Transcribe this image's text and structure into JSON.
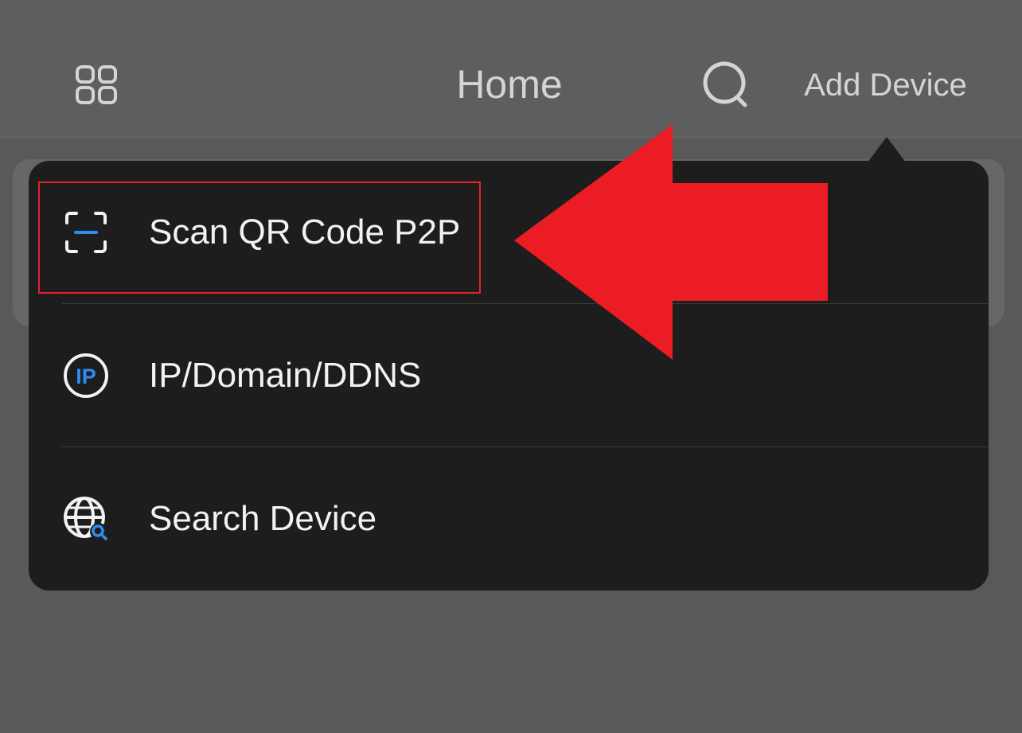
{
  "header": {
    "title": "Home",
    "add_device_label": "Add Device",
    "left_icon": "grid-icon",
    "search_icon": "search-icon"
  },
  "menu": {
    "items": [
      {
        "label": "Scan QR Code P2P",
        "icon": "qr-scan-icon",
        "highlighted": true
      },
      {
        "label": "IP/Domain/DDNS",
        "icon": "ip-icon",
        "icon_text": "IP"
      },
      {
        "label": "Search Device",
        "icon": "globe-search-icon"
      }
    ]
  },
  "colors": {
    "background": "#595959",
    "header": "#5e5e5e",
    "menu_background": "#1d1d1d",
    "accent_blue": "#2f8cf0",
    "annotation_red": "#ec1c24"
  }
}
